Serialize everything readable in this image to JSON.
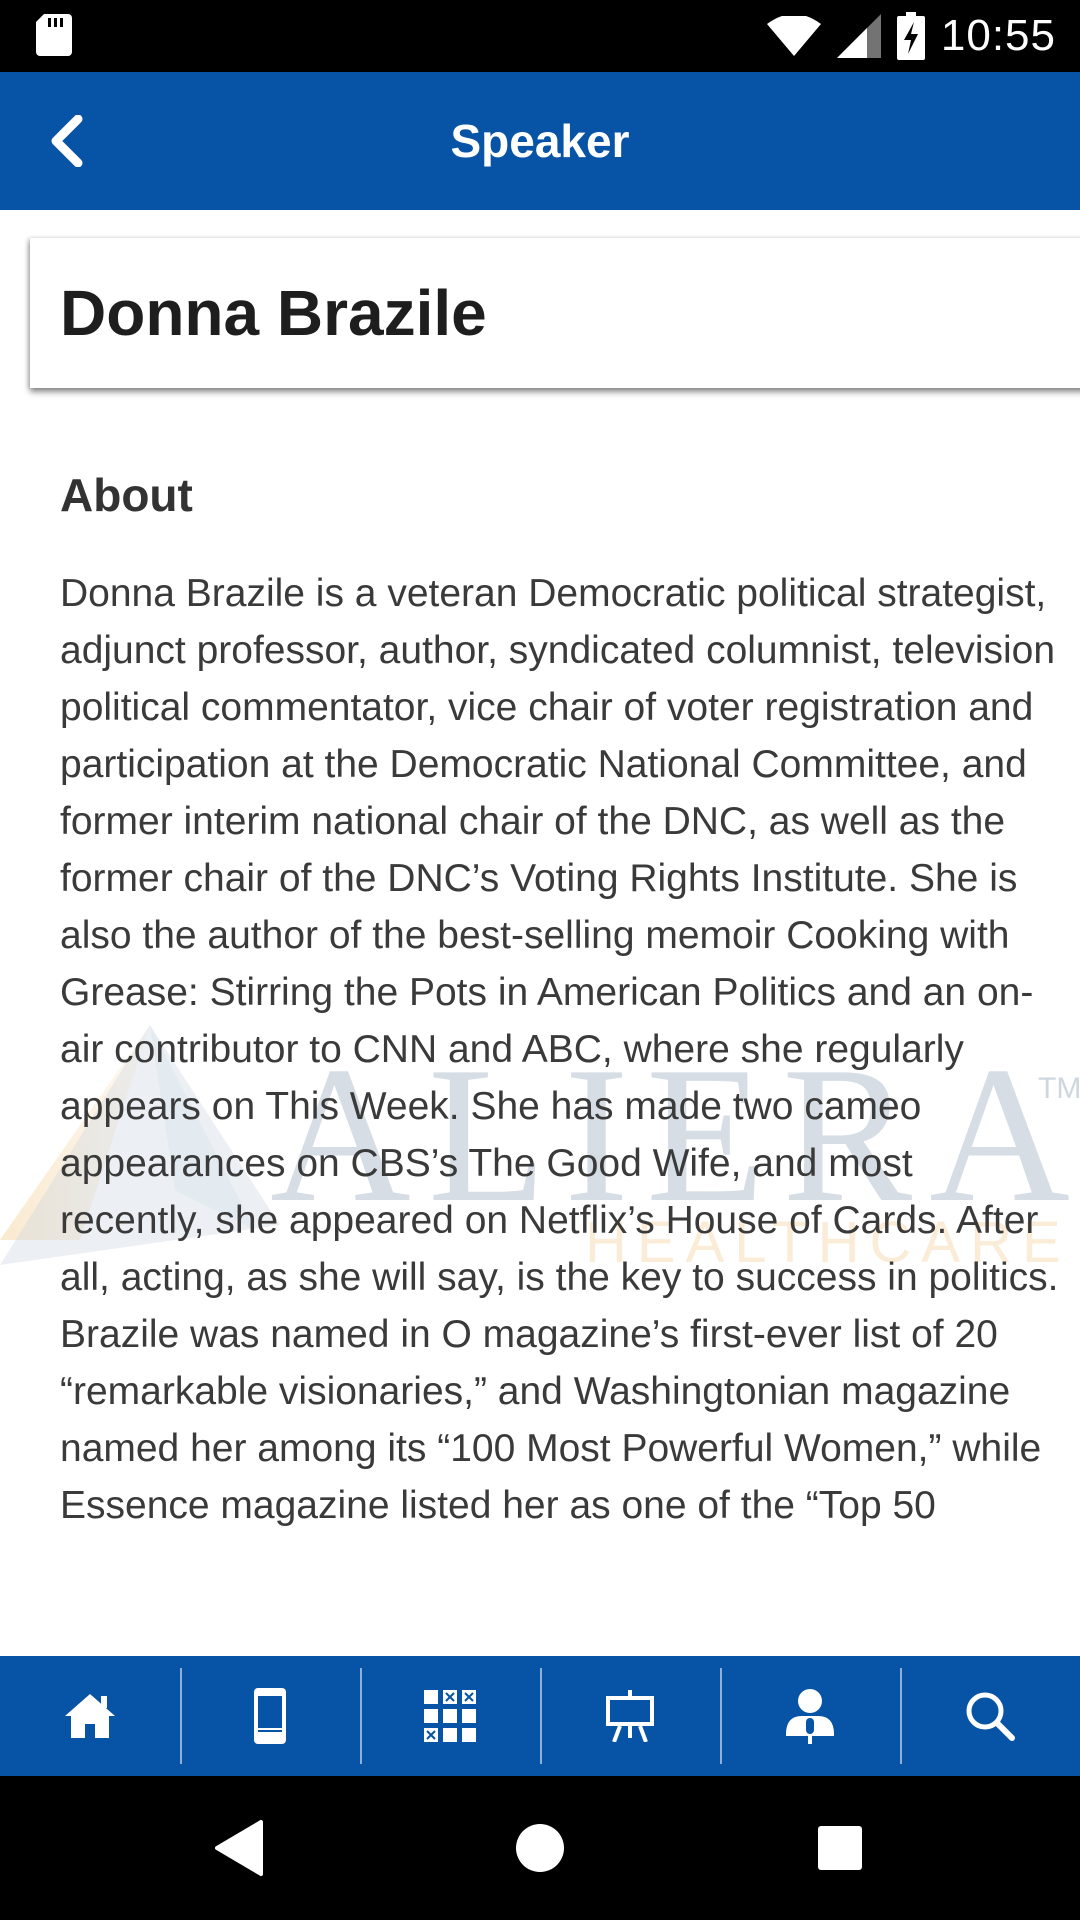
{
  "status_bar": {
    "time": "10:55",
    "icons": [
      "sd-card-icon",
      "wifi-icon",
      "signal-icon",
      "battery-charging-icon"
    ]
  },
  "app_bar": {
    "title": "Speaker",
    "back_icon": "chevron-left-icon"
  },
  "speaker": {
    "name": "Donna Brazile"
  },
  "about": {
    "heading": "About",
    "bio": "Donna Brazile is a veteran Democratic political strategist, adjunct professor, author, syndicated columnist, television political commentator, vice chair of voter registration and participation at the Democratic National Committee, and former interim national chair of the DNC, as well as the former chair of the DNC’s Voting Rights Institute. She is also the author of the best-selling memoir Cooking with Grease: Stirring the Pots in American Politics and an on-air contributor to CNN and ABC, where she regularly appears on This Week. She has made two cameo appearances on CBS’s The Good Wife, and most recently, she appeared on Netflix’s House of Cards. After all, acting, as she will say, is the key to success in politics. Brazile was named in O magazine’s first-ever list of 20 “remarkable visionaries,” and Washingtonian magazine named her among its “100 Most Powerful Women,” while Essence magazine listed her as one of the “Top 50"
  },
  "watermark": {
    "brand": "ALIERA",
    "sub": "HEALTHCARE",
    "tm": "TM",
    "colors": {
      "brand": "#aebccb",
      "sub": "#f6d7a8"
    }
  },
  "tab_bar": {
    "tabs": [
      {
        "icon": "home-icon"
      },
      {
        "icon": "mobile-device-icon"
      },
      {
        "icon": "grid-apps-icon"
      },
      {
        "icon": "presentation-board-icon"
      },
      {
        "icon": "speaker-person-icon"
      },
      {
        "icon": "search-icon"
      }
    ]
  },
  "nav_bar": {
    "buttons": [
      "back-triangle-icon",
      "home-circle-icon",
      "recents-square-icon"
    ]
  },
  "colors": {
    "primary": "#0753a5",
    "text_dark": "#1e1e1e",
    "text_body": "#3a3a3a"
  }
}
